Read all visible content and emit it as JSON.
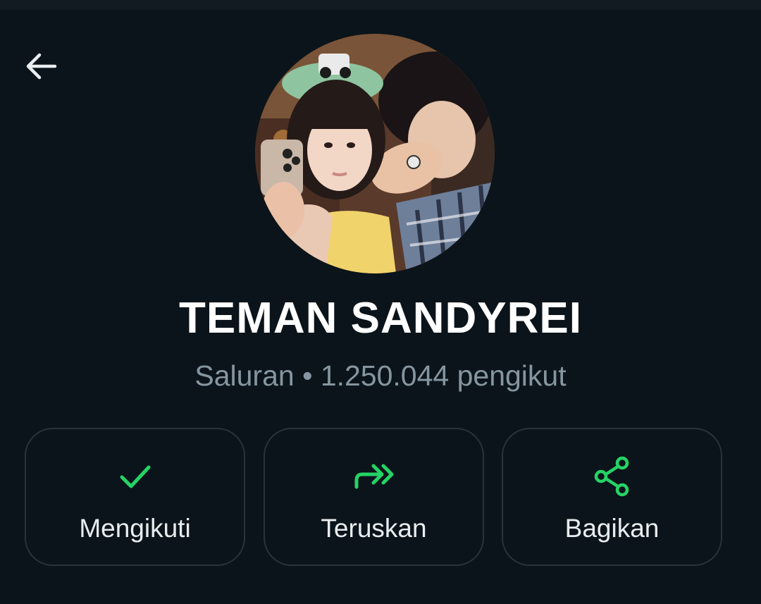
{
  "header": {
    "back_icon": "arrow-left-icon"
  },
  "channel": {
    "avatar": "channel-avatar-photo",
    "name": "TEMAN SANDYREI",
    "subtitle": "Saluran • 1.250.044 pengikut"
  },
  "actions": [
    {
      "label": "Mengikuti",
      "icon": "check-icon"
    },
    {
      "label": "Teruskan",
      "icon": "forward-icon"
    },
    {
      "label": "Bagikan",
      "icon": "share-icon"
    }
  ],
  "colors": {
    "background": "#0b141a",
    "accent": "#25d366",
    "text": "#e9edef",
    "muted": "#8696a0",
    "border": "#2a3338"
  }
}
